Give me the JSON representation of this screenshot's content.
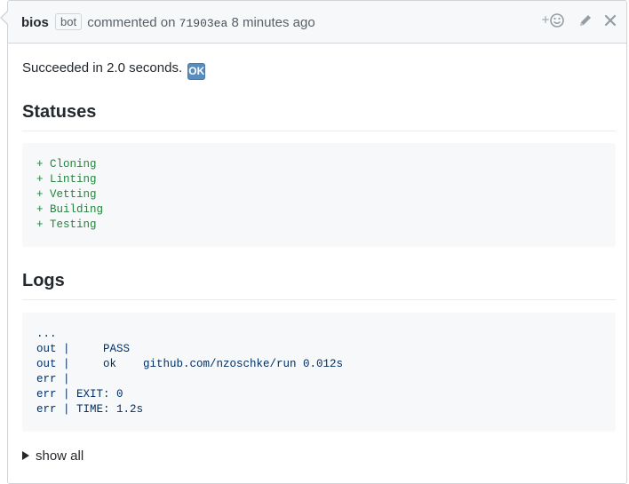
{
  "header": {
    "author": "bios",
    "bot_label": "bot",
    "commented_on": "commented on",
    "commit_sha": "71903ea",
    "time_ago": "8 minutes ago",
    "icons": {
      "reaction": "add-reaction-icon",
      "edit": "pencil-icon",
      "close": "close-icon"
    }
  },
  "body": {
    "status_text": "Succeeded in 2.0 seconds.",
    "status_emoji": "OK",
    "statuses_heading": "Statuses",
    "statuses": [
      "+ Cloning",
      "+ Linting",
      "+ Vetting",
      "+ Building",
      "+ Testing"
    ],
    "logs_heading": "Logs",
    "logs": [
      "...",
      "out |     PASS",
      "out |     ok    github.com/nzoschke/run 0.012s",
      "err |",
      "err | EXIT: 0",
      "err | TIME: 1.2s"
    ],
    "show_all_label": "show all"
  },
  "colors": {
    "diff_add": "#22863a",
    "log_text": "#032f62",
    "code_bg": "#f6f8fa",
    "header_bg": "#f6f8fa",
    "ok_emoji_bg": "#5a8dbf"
  }
}
